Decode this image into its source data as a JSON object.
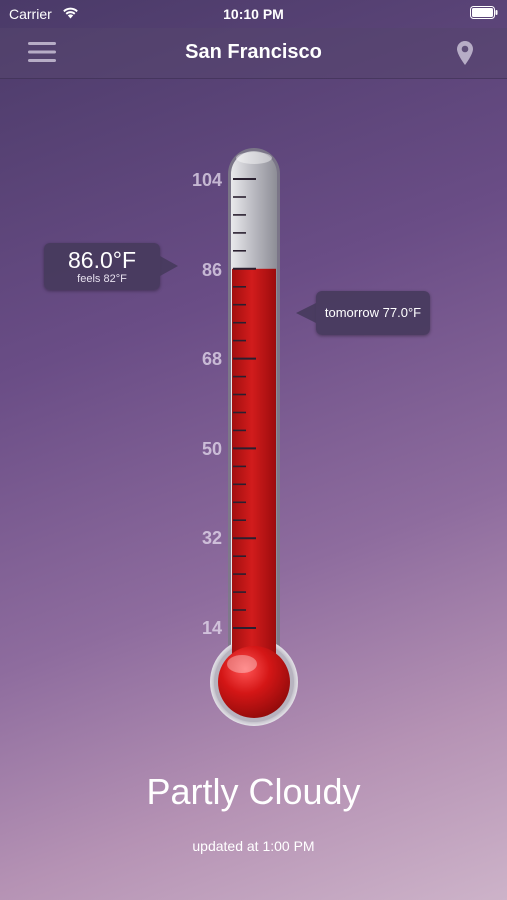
{
  "status_bar": {
    "carrier": "Carrier",
    "time": "10:10 PM"
  },
  "nav": {
    "title": "San Francisco",
    "menu_icon": "hamburger-menu-icon",
    "location_icon": "map-pin-icon"
  },
  "thermometer": {
    "scale_labels": [
      "104",
      "86",
      "68",
      "50",
      "32",
      "14"
    ],
    "mercury_level": 86,
    "mercury_color": "#cc1818",
    "current": {
      "temp": "86.0°F",
      "feels_like": "feels 82°F"
    },
    "tomorrow": "tomorrow 77.0°F"
  },
  "weather": {
    "condition": "Partly Cloudy",
    "updated": "updated at 1:00 PM"
  }
}
